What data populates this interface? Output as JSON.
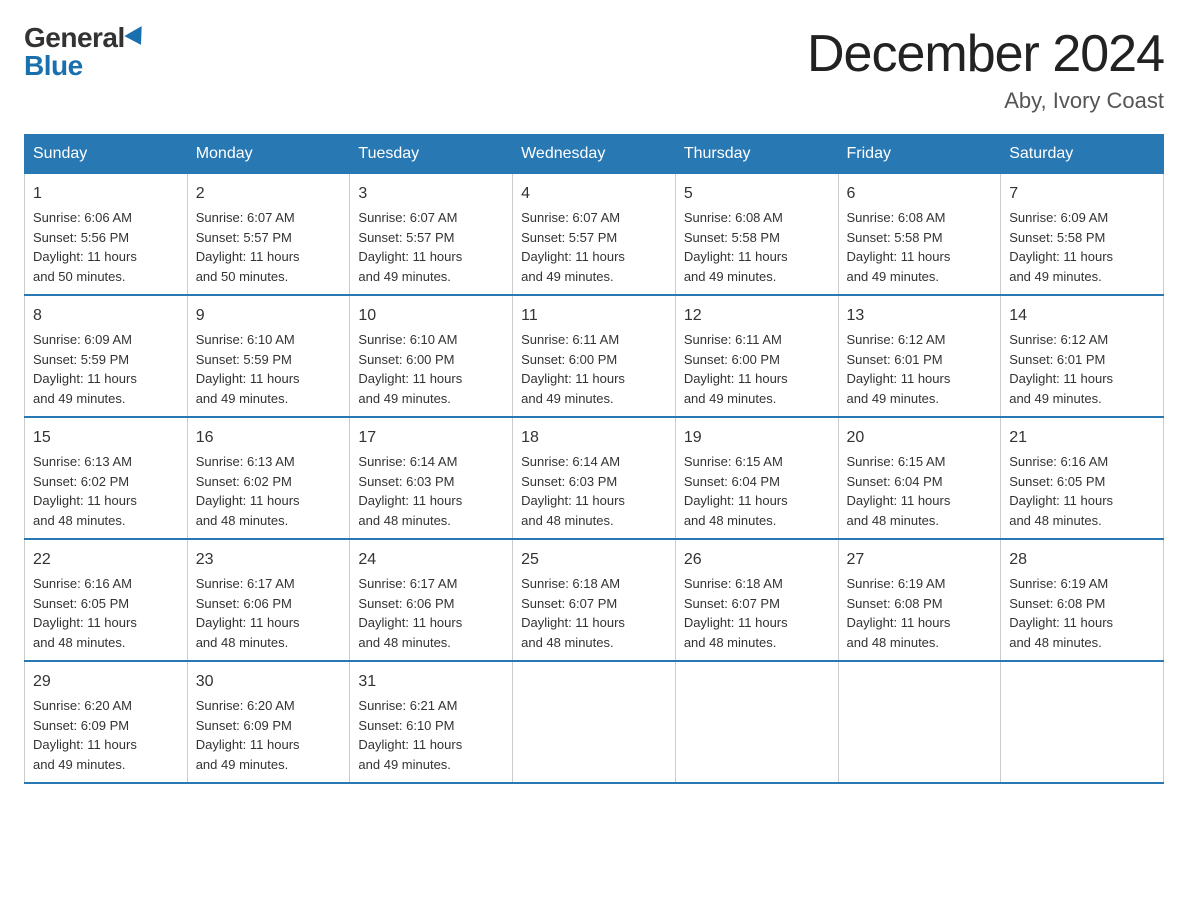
{
  "logo": {
    "general": "General",
    "blue": "Blue"
  },
  "title": "December 2024",
  "location": "Aby, Ivory Coast",
  "days_of_week": [
    "Sunday",
    "Monday",
    "Tuesday",
    "Wednesday",
    "Thursday",
    "Friday",
    "Saturday"
  ],
  "weeks": [
    [
      {
        "day": "1",
        "sunrise": "6:06 AM",
        "sunset": "5:56 PM",
        "daylight": "11 hours and 50 minutes."
      },
      {
        "day": "2",
        "sunrise": "6:07 AM",
        "sunset": "5:57 PM",
        "daylight": "11 hours and 50 minutes."
      },
      {
        "day": "3",
        "sunrise": "6:07 AM",
        "sunset": "5:57 PM",
        "daylight": "11 hours and 49 minutes."
      },
      {
        "day": "4",
        "sunrise": "6:07 AM",
        "sunset": "5:57 PM",
        "daylight": "11 hours and 49 minutes."
      },
      {
        "day": "5",
        "sunrise": "6:08 AM",
        "sunset": "5:58 PM",
        "daylight": "11 hours and 49 minutes."
      },
      {
        "day": "6",
        "sunrise": "6:08 AM",
        "sunset": "5:58 PM",
        "daylight": "11 hours and 49 minutes."
      },
      {
        "day": "7",
        "sunrise": "6:09 AM",
        "sunset": "5:58 PM",
        "daylight": "11 hours and 49 minutes."
      }
    ],
    [
      {
        "day": "8",
        "sunrise": "6:09 AM",
        "sunset": "5:59 PM",
        "daylight": "11 hours and 49 minutes."
      },
      {
        "day": "9",
        "sunrise": "6:10 AM",
        "sunset": "5:59 PM",
        "daylight": "11 hours and 49 minutes."
      },
      {
        "day": "10",
        "sunrise": "6:10 AM",
        "sunset": "6:00 PM",
        "daylight": "11 hours and 49 minutes."
      },
      {
        "day": "11",
        "sunrise": "6:11 AM",
        "sunset": "6:00 PM",
        "daylight": "11 hours and 49 minutes."
      },
      {
        "day": "12",
        "sunrise": "6:11 AM",
        "sunset": "6:00 PM",
        "daylight": "11 hours and 49 minutes."
      },
      {
        "day": "13",
        "sunrise": "6:12 AM",
        "sunset": "6:01 PM",
        "daylight": "11 hours and 49 minutes."
      },
      {
        "day": "14",
        "sunrise": "6:12 AM",
        "sunset": "6:01 PM",
        "daylight": "11 hours and 49 minutes."
      }
    ],
    [
      {
        "day": "15",
        "sunrise": "6:13 AM",
        "sunset": "6:02 PM",
        "daylight": "11 hours and 48 minutes."
      },
      {
        "day": "16",
        "sunrise": "6:13 AM",
        "sunset": "6:02 PM",
        "daylight": "11 hours and 48 minutes."
      },
      {
        "day": "17",
        "sunrise": "6:14 AM",
        "sunset": "6:03 PM",
        "daylight": "11 hours and 48 minutes."
      },
      {
        "day": "18",
        "sunrise": "6:14 AM",
        "sunset": "6:03 PM",
        "daylight": "11 hours and 48 minutes."
      },
      {
        "day": "19",
        "sunrise": "6:15 AM",
        "sunset": "6:04 PM",
        "daylight": "11 hours and 48 minutes."
      },
      {
        "day": "20",
        "sunrise": "6:15 AM",
        "sunset": "6:04 PM",
        "daylight": "11 hours and 48 minutes."
      },
      {
        "day": "21",
        "sunrise": "6:16 AM",
        "sunset": "6:05 PM",
        "daylight": "11 hours and 48 minutes."
      }
    ],
    [
      {
        "day": "22",
        "sunrise": "6:16 AM",
        "sunset": "6:05 PM",
        "daylight": "11 hours and 48 minutes."
      },
      {
        "day": "23",
        "sunrise": "6:17 AM",
        "sunset": "6:06 PM",
        "daylight": "11 hours and 48 minutes."
      },
      {
        "day": "24",
        "sunrise": "6:17 AM",
        "sunset": "6:06 PM",
        "daylight": "11 hours and 48 minutes."
      },
      {
        "day": "25",
        "sunrise": "6:18 AM",
        "sunset": "6:07 PM",
        "daylight": "11 hours and 48 minutes."
      },
      {
        "day": "26",
        "sunrise": "6:18 AM",
        "sunset": "6:07 PM",
        "daylight": "11 hours and 48 minutes."
      },
      {
        "day": "27",
        "sunrise": "6:19 AM",
        "sunset": "6:08 PM",
        "daylight": "11 hours and 48 minutes."
      },
      {
        "day": "28",
        "sunrise": "6:19 AM",
        "sunset": "6:08 PM",
        "daylight": "11 hours and 48 minutes."
      }
    ],
    [
      {
        "day": "29",
        "sunrise": "6:20 AM",
        "sunset": "6:09 PM",
        "daylight": "11 hours and 49 minutes."
      },
      {
        "day": "30",
        "sunrise": "6:20 AM",
        "sunset": "6:09 PM",
        "daylight": "11 hours and 49 minutes."
      },
      {
        "day": "31",
        "sunrise": "6:21 AM",
        "sunset": "6:10 PM",
        "daylight": "11 hours and 49 minutes."
      },
      null,
      null,
      null,
      null
    ]
  ],
  "labels": {
    "sunrise": "Sunrise:",
    "sunset": "Sunset:",
    "daylight": "Daylight:"
  }
}
